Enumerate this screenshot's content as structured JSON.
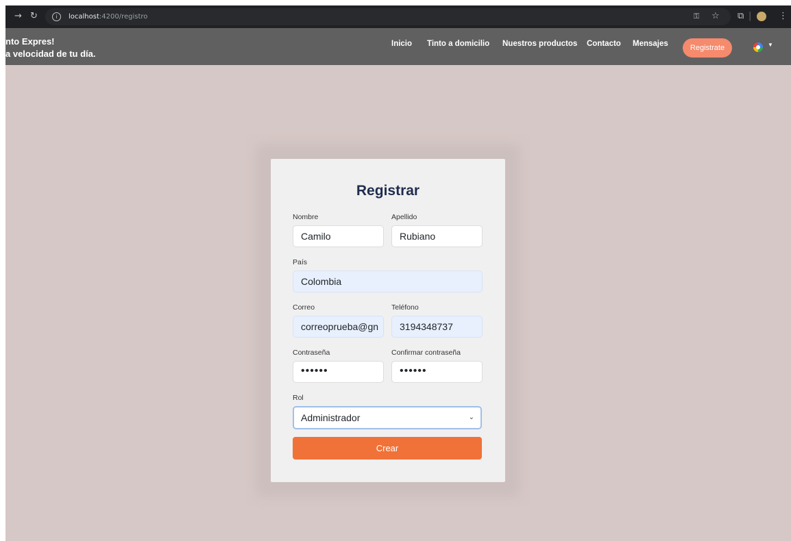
{
  "browser": {
    "url_host": "localhost",
    "url_rest": ":4200/registro",
    "icons": [
      "forward-icon",
      "reload-icon",
      "info-icon",
      "key-icon",
      "star-icon",
      "extensions-icon",
      "profile-icon",
      "menu-icon"
    ]
  },
  "navbar": {
    "brand_line1": "nto Expres!",
    "brand_line2": "a velocidad de tu día.",
    "links": [
      "Inicio",
      "Tinto a domicilio",
      "Nuestros productos",
      "Contacto",
      "Mensajes"
    ],
    "register_label": "Registrate",
    "colors": {
      "bar": "#606060",
      "register": "#f58a6c"
    }
  },
  "form": {
    "title": "Registrar",
    "nombre_label": "Nombre",
    "nombre_value": "Camilo",
    "apellido_label": "Apellido",
    "apellido_value": "Rubiano",
    "pais_label": "País",
    "pais_value": "Colombia",
    "correo_label": "Correo",
    "correo_value": "correoprueba@gn",
    "telefono_label": "Teléfono",
    "telefono_value": "3194348737",
    "password_label": "Contraseña",
    "password_value": "••••••",
    "confirm_label": "Confirmar contraseña",
    "confirm_value": "••••••",
    "rol_label": "Rol",
    "rol_selected": "Administrador",
    "submit_label": "Crear",
    "colors": {
      "submit": "#f07238",
      "background": "#d6c8c6",
      "title": "#1f2d4d"
    }
  }
}
